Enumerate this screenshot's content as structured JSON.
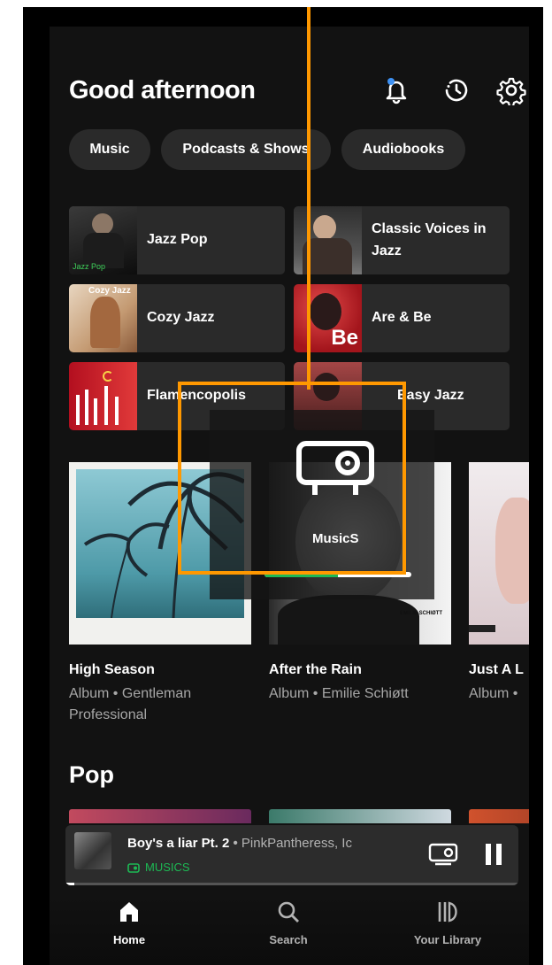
{
  "header": {
    "greeting": "Good afternoon"
  },
  "icons": {
    "notifications": "bell-icon",
    "history": "recent-clock-icon",
    "settings": "gear-icon"
  },
  "filters": [
    "Music",
    "Podcasts & Shows",
    "Audiobooks"
  ],
  "shortcuts": [
    {
      "label": "Jazz Pop",
      "thumb_text": "Jazz Pop"
    },
    {
      "label": "Classic Voices in Jazz"
    },
    {
      "label": "Cozy Jazz",
      "thumb_text": "Cozy Jazz"
    },
    {
      "label": "Are & Be",
      "thumb_text": "Be"
    },
    {
      "label": "Flamencopolis"
    },
    {
      "label": "Easy Jazz"
    }
  ],
  "albums": [
    {
      "title": "High Season",
      "subtitle": "Album • Gentleman Professional"
    },
    {
      "title": "After the Rain",
      "subtitle": "Album • Emilie Schiøtt",
      "art_text": "EMILIE SCHIØTT"
    },
    {
      "title": "Just A L",
      "subtitle": "Album •"
    }
  ],
  "sections": {
    "pop": "Pop"
  },
  "now_playing": {
    "title": "Boy's a liar Pt. 2",
    "artist": "PinkPantheress, Ic",
    "device": "MUSICS",
    "progress": 0.02
  },
  "overlay": {
    "device_name": "MusicS",
    "volume": 0.5
  },
  "nav": [
    {
      "label": "Home",
      "icon": "home-icon"
    },
    {
      "label": "Search",
      "icon": "search-icon"
    },
    {
      "label": "Your Library",
      "icon": "library-icon"
    }
  ],
  "colors": {
    "accent": "#1db954",
    "annotation": "#ff9800",
    "background": "#121212",
    "card": "#2a2a2a"
  }
}
